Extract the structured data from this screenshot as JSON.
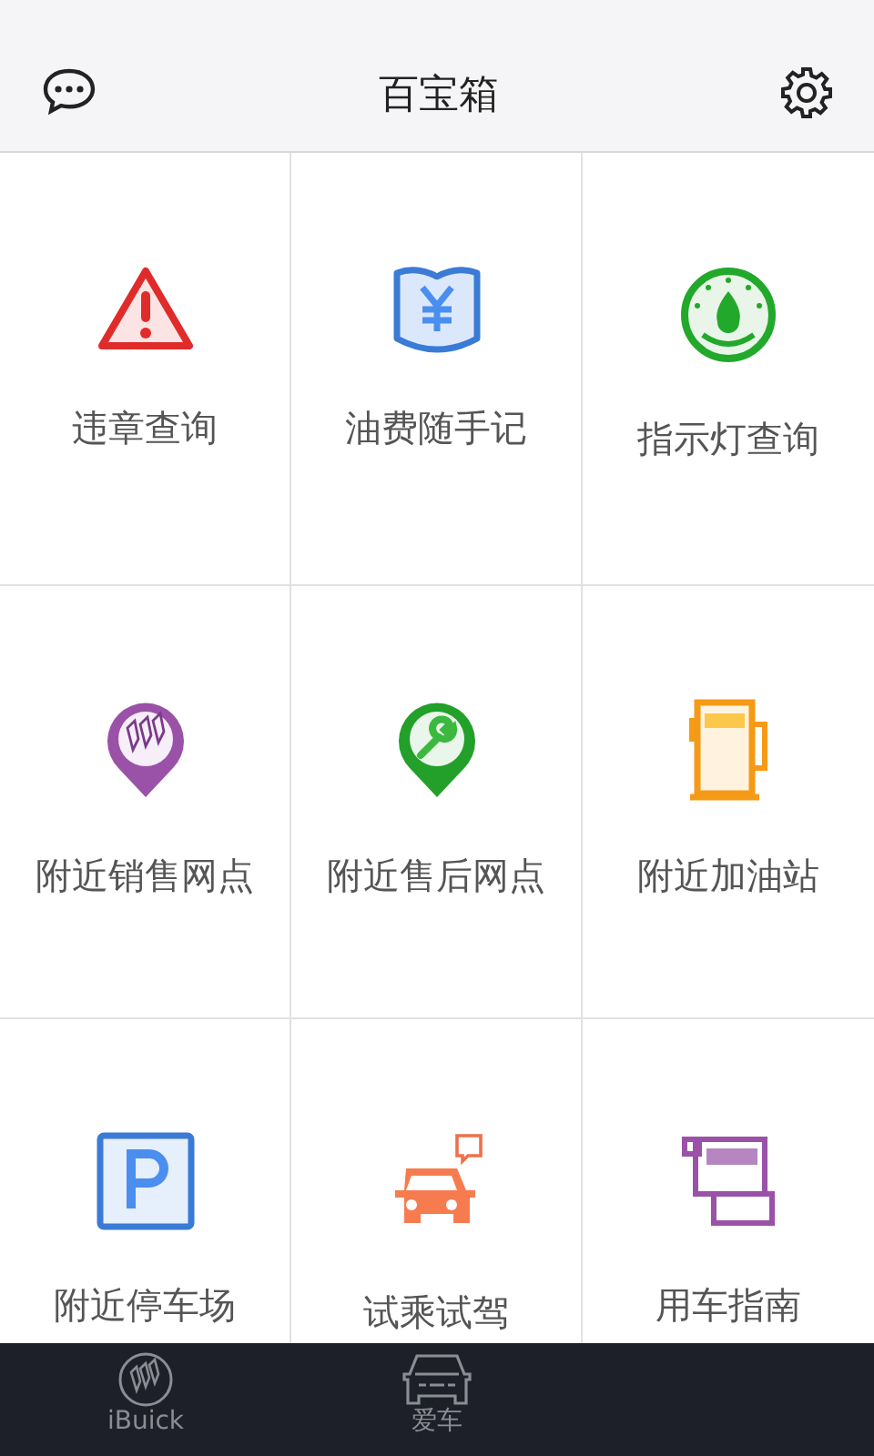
{
  "header": {
    "title": "百宝箱"
  },
  "tools": [
    {
      "label": "违章查询",
      "kind": "warning"
    },
    {
      "label": "油费随手记",
      "kind": "ledger"
    },
    {
      "label": "指示灯查询",
      "kind": "gauge"
    },
    {
      "label": "附近销售网点",
      "kind": "dealer"
    },
    {
      "label": "附近售后网点",
      "kind": "service"
    },
    {
      "label": "附近加油站",
      "kind": "fuel"
    },
    {
      "label": "附近停车场",
      "kind": "parking"
    },
    {
      "label": "试乘试驾",
      "kind": "car"
    },
    {
      "label": "用车指南",
      "kind": "guide"
    }
  ],
  "tab_bar": [
    {
      "label": "iBuick",
      "kind": "brand"
    },
    {
      "label": "爱车",
      "kind": "car"
    }
  ]
}
